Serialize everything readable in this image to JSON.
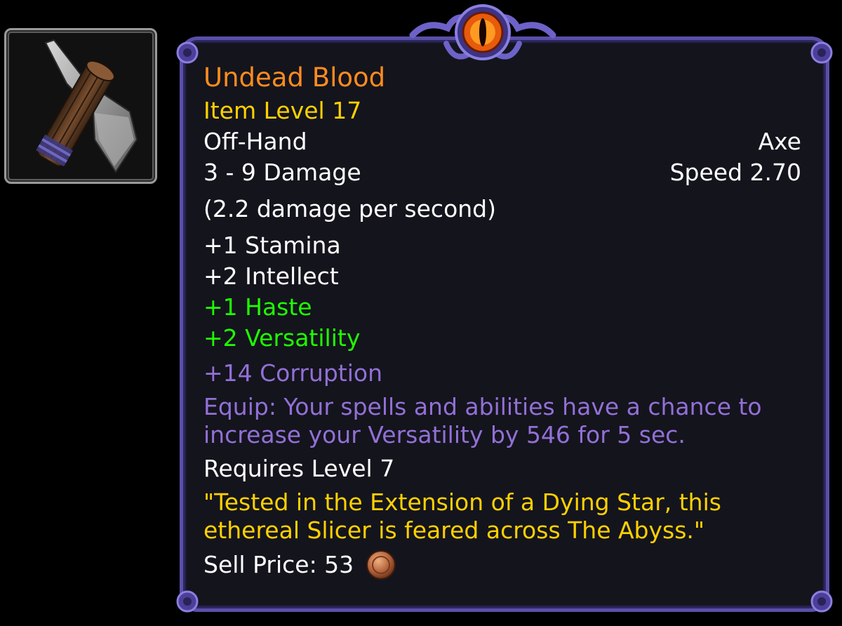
{
  "item": {
    "name": "Undead Blood",
    "item_level": "Item Level 17",
    "slot": "Off-Hand",
    "type": "Axe",
    "damage": "3 - 9 Damage",
    "speed": "Speed 2.70",
    "dps": "(2.2 damage per second)",
    "stats": [
      "+1 Stamina",
      "+2 Intellect"
    ],
    "bonus_stats": [
      "+1 Haste",
      "+2 Versatility"
    ],
    "corruption": "+14 Corruption",
    "equip_effect": "Equip: Your spells and abilities have a chance to increase your Versatility by 546 for 5 sec.",
    "requires": "Requires Level 7",
    "flavor": "\"Tested in the Extension of a Dying Star, this ethereal Slicer is feared across The Abyss.\"",
    "sell_price": "Sell Price: 53",
    "sell_coin": "copper-coin-icon"
  },
  "colors": {
    "name": "#ff8c1e",
    "item_level": "#ffd100",
    "white": "#ffffff",
    "green": "#1eff00",
    "purple": "#9270d6",
    "flavor": "#ffd100",
    "border": "#5a4fa8"
  },
  "icon": "axe-icon"
}
